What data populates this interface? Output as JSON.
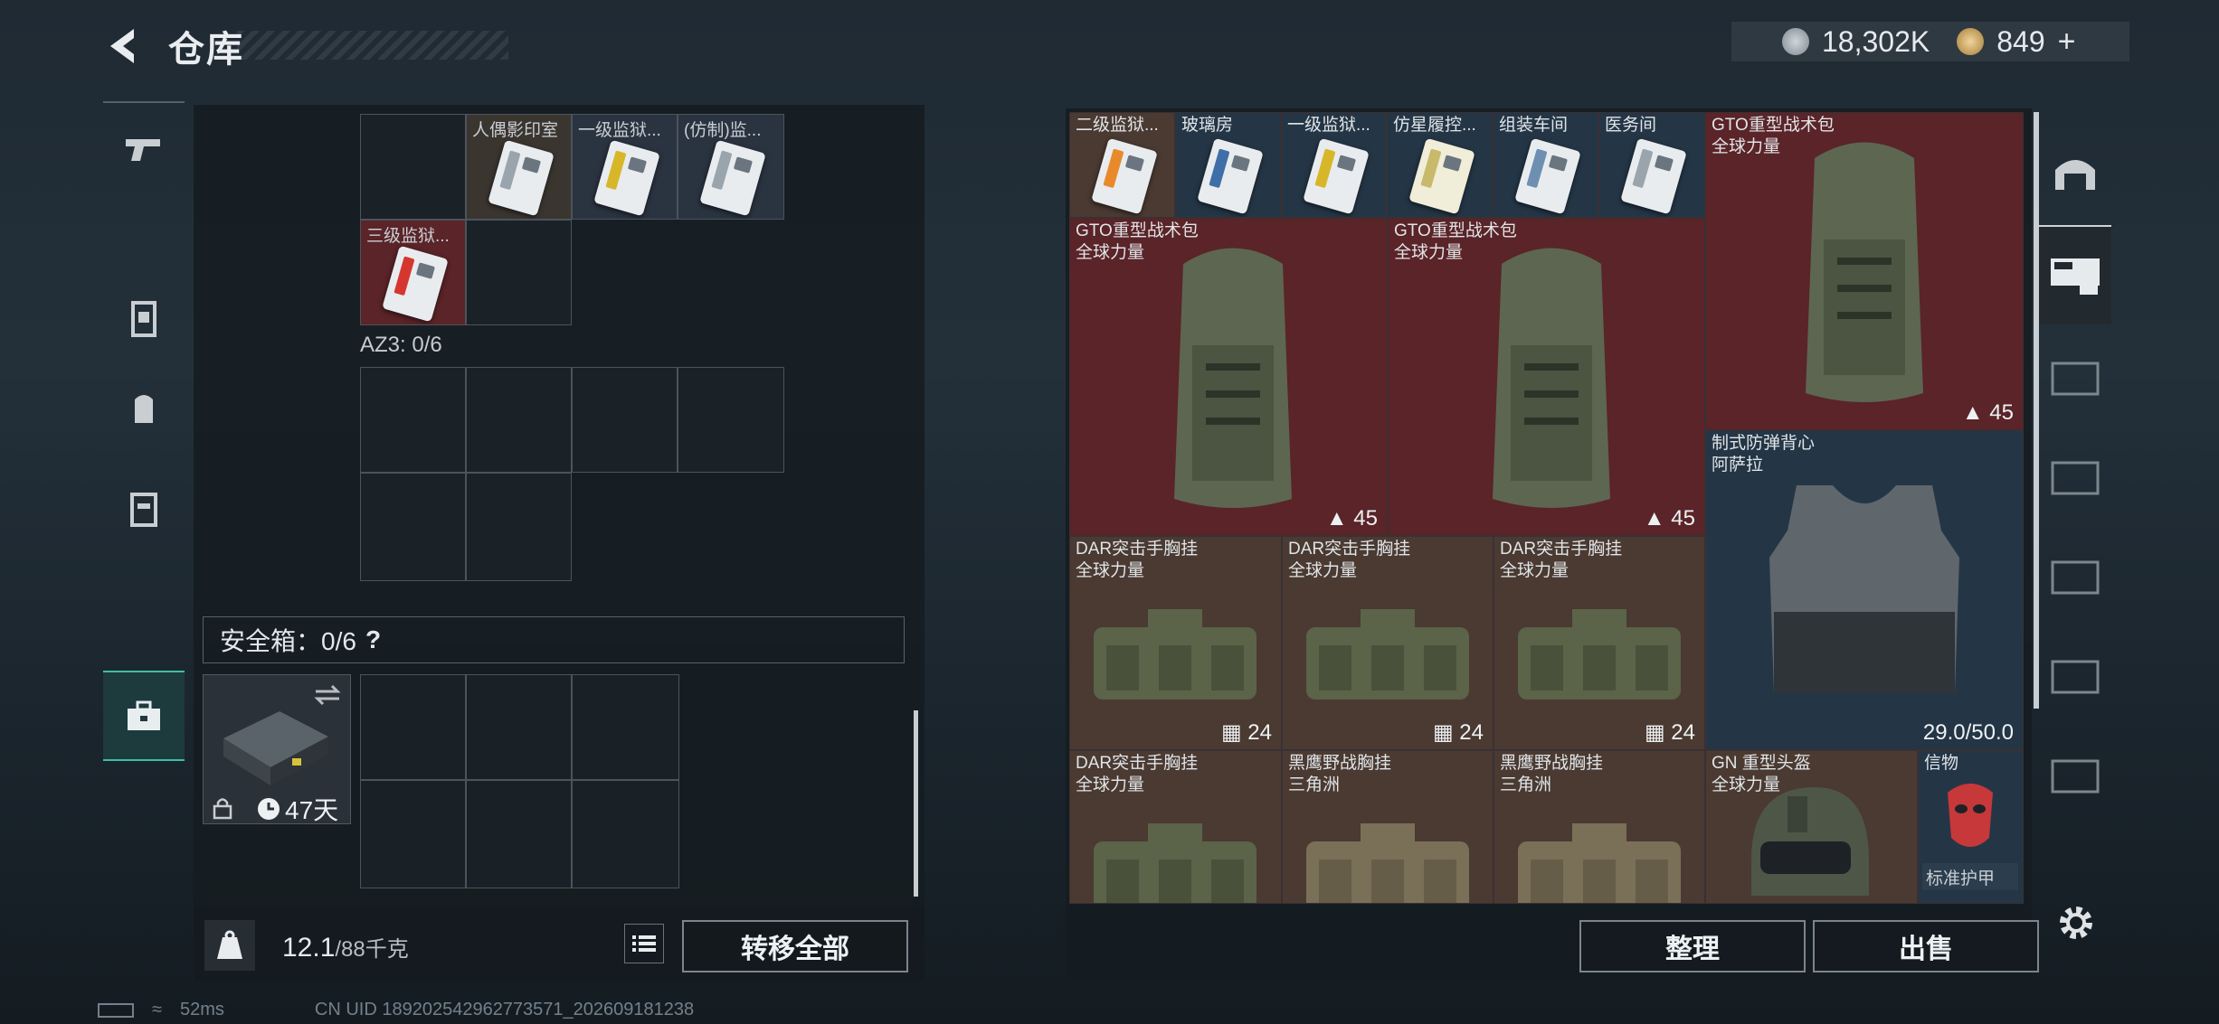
{
  "header": {
    "title": "仓库",
    "currency_1": "18,302K",
    "currency_2": "849"
  },
  "left_nav": [
    {
      "name": "weapon"
    },
    {
      "name": "armor"
    },
    {
      "name": "backpack"
    },
    {
      "name": "rig"
    },
    {
      "name": "safebox"
    }
  ],
  "keycards_row1": [
    "人偶影印室",
    "一级监狱...",
    "(仿制)监..."
  ],
  "keycards_row2": [
    "三级监狱..."
  ],
  "az3_label": "AZ3: 0/6",
  "safe_label": "安全箱：0/6",
  "safe_help": "?",
  "safe_days": "47天",
  "weight": {
    "current": "12.1",
    "max": "/88千克"
  },
  "buttons": {
    "transfer_all": "转移全部",
    "sort": "整理",
    "sell": "出售"
  },
  "stash_cards": [
    "二级监狱...",
    "玻璃房",
    "一级监狱...",
    "仿星履控...",
    "组装车间",
    "医务间"
  ],
  "backpacks": [
    {
      "name": "GTO重型战术包",
      "sub": "全球力量",
      "count": "45"
    },
    {
      "name": "GTO重型战术包",
      "sub": "全球力量",
      "count": "45"
    },
    {
      "name": "GTO重型战术包",
      "sub": "全球力量",
      "count": "45"
    }
  ],
  "vest": {
    "name": "制式防弹背心",
    "sub": "阿萨拉",
    "durability": "29.0/50.0"
  },
  "rigs": [
    {
      "name": "DAR突击手胸挂",
      "sub": "全球力量",
      "count": "24"
    },
    {
      "name": "DAR突击手胸挂",
      "sub": "全球力量",
      "count": "24"
    },
    {
      "name": "DAR突击手胸挂",
      "sub": "全球力量",
      "count": "24"
    }
  ],
  "rigs_row2": [
    {
      "name": "DAR突击手胸挂",
      "sub": "全球力量"
    },
    {
      "name": "黑鹰野战胸挂",
      "sub": "三角洲"
    },
    {
      "name": "黑鹰野战胸挂",
      "sub": "三角洲"
    }
  ],
  "helmet": {
    "name": "GN 重型头盔",
    "sub": "全球力量"
  },
  "token": {
    "name": "信物",
    "sub": "标准护甲"
  },
  "footer": {
    "ping": "52ms",
    "uid": "CN UID 1892025429627735​71_202609181238"
  }
}
